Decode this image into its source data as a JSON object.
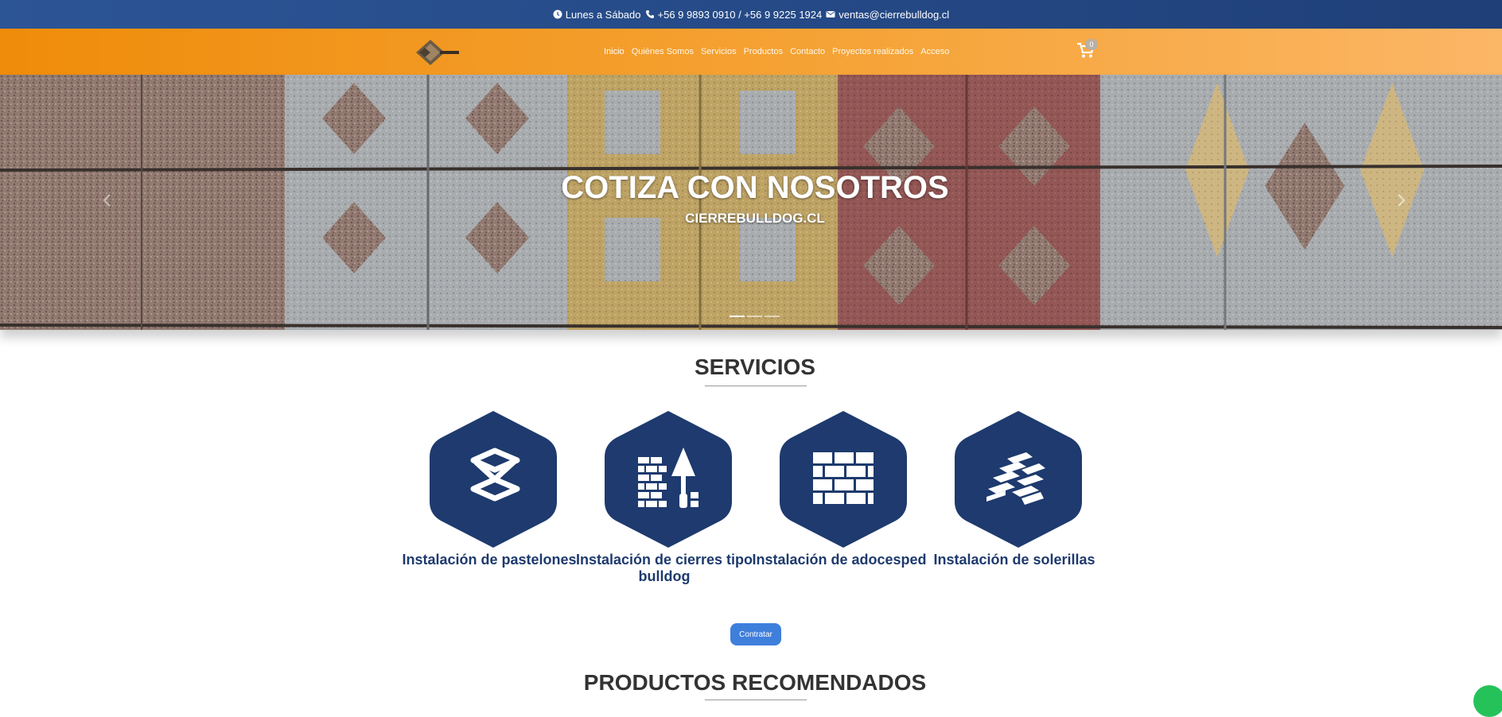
{
  "topbar": {
    "hours": "Lunes a Sábado",
    "phones": "+56 9 9893 0910 / +56 9 9225 1924",
    "email": "ventas@cierrebulldog.cl"
  },
  "header": {
    "logo_text": "CIERRE BULLDOG",
    "nav": [
      "Inicio",
      "Quiénes Somos",
      "Servicios",
      "Productos",
      "Contacto",
      "Proyectos realizados",
      "Acceso"
    ],
    "cart_count": "0"
  },
  "hero": {
    "title": "COTIZA CON NOSOTROS",
    "subtitle": "CIERREBULLDOG.CL",
    "slides": 3,
    "active_slide": 1
  },
  "services": {
    "title": "SERVICIOS",
    "items": [
      {
        "label": "Instalación de pastelones",
        "icon": "paver-icon"
      },
      {
        "label": "Instalación de cierres tipo bulldog",
        "icon": "brick-wall-trowel-icon"
      },
      {
        "label": "Instalación de adocesped",
        "icon": "brick-wall-icon"
      },
      {
        "label": "Instalación de solerillas",
        "icon": "brick-stack-icon"
      }
    ],
    "button": "Contratar"
  },
  "products": {
    "title": "PRODUCTOS RECOMENDADOS"
  },
  "colors": {
    "topbar": "#2c5596",
    "navbar": "#f29a1f",
    "service_blue": "#1e3a6e",
    "button_blue": "#3f7fdc",
    "whatsapp_green": "#25c25a"
  }
}
